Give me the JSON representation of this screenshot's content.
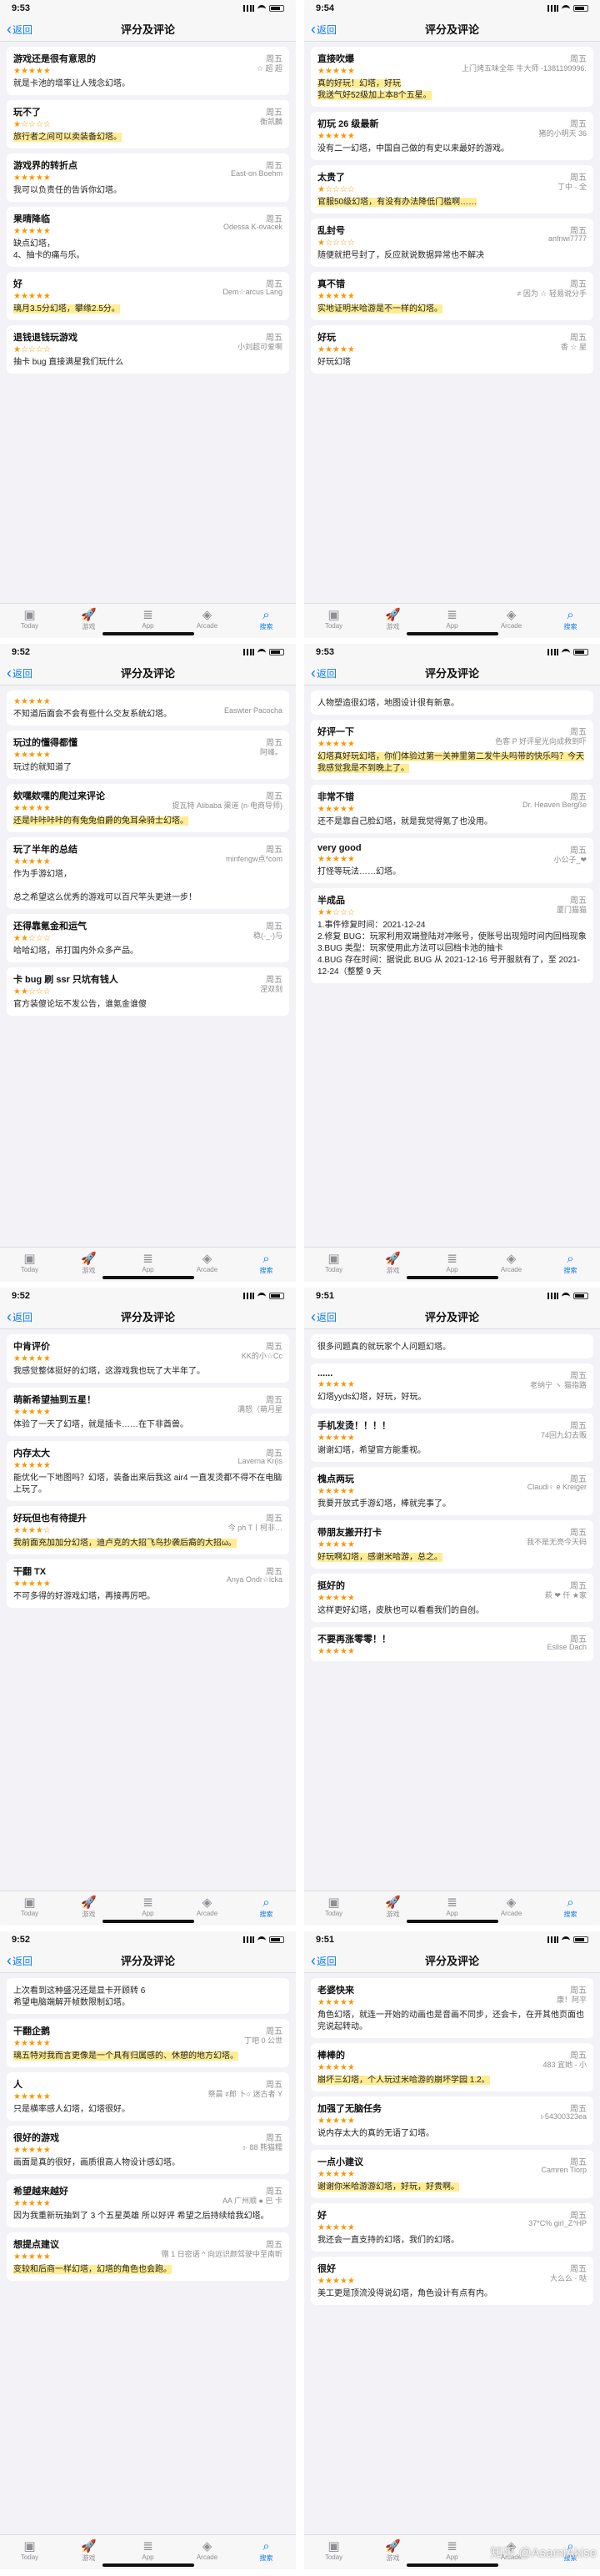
{
  "nav": {
    "title": "评分及评论",
    "back_label": "返回"
  },
  "tabs": [
    "Today",
    "游戏",
    "App",
    "Arcade",
    "搜索"
  ],
  "watermark": "知乎 @AsamiAkise",
  "colors": {
    "star": "#ff9500",
    "accent": "#0a7aff",
    "highlight": "#ffdf3c"
  },
  "screens": [
    {
      "time": "9:53",
      "reviews": [
        {
          "title": "游戏还是很有意思的",
          "day": "周五",
          "author": "☆ 超 超",
          "stars": 5,
          "body": "就是卡池的增率让人残念幻塔。"
        },
        {
          "title": "玩不了",
          "day": "周五",
          "author": "衡凯麟",
          "stars": 1,
          "body": "旅行者之间可以卖装备幻塔。"
        },
        {
          "title": "游戏界的转折点",
          "day": "周五",
          "author": "East-on Boehm",
          "stars": 5,
          "body": "我可以负责任的告诉你幻塔。"
        },
        {
          "title": "果晴降临",
          "day": "周五",
          "author": "Odessa K-ovacek",
          "stars": 5,
          "body": "缺点幻塔，\n4、抽卡的痛与乐。"
        },
        {
          "title": "好",
          "day": "周五",
          "author": "Dem☆arcus Lang",
          "stars": 5,
          "body": "璃月3.5分幻塔，攀缘2.5分。"
        },
        {
          "title": "退钱退钱玩游戏",
          "day": "周五",
          "author": "小刘超可爱啊",
          "stars": 1,
          "body": "抽卡 bug 直接满星我们玩什么"
        }
      ]
    },
    {
      "time": "9:54",
      "reviews": [
        {
          "title": "直接吹爆",
          "day": "周五",
          "author": "上门烤五味全年 牛大师 -1381199996...",
          "stars": 5,
          "body": "真的好玩！幻塔，好玩\n我送气好52级加上本8个五星。"
        },
        {
          "title": "初玩 26 级最新",
          "day": "周五",
          "author": "猪的小明天 36",
          "stars": 5,
          "body": "没有二一幻塔，中国自己做的有史以来最好的游戏。"
        },
        {
          "title": "太贵了",
          "day": "周五",
          "author": "丁中 · 全",
          "stars": 1,
          "body": "官服50级幻塔，有没有办法降低门槛啊……"
        },
        {
          "title": "乱封号",
          "day": "周五",
          "author": "anfnwi7777",
          "stars": 1,
          "body": "随便就把号封了，反应就说数据异常也不解决"
        },
        {
          "title": "真不错",
          "day": "周五",
          "author": "≠ 因为 ☆ 轻易说分手",
          "stars": 5,
          "body": "实地证明米哈游是不一样的幻塔。"
        },
        {
          "title": "好玩",
          "day": "周五",
          "author": "香 ☆ 星",
          "stars": 5,
          "body": "好玩幻塔"
        }
      ]
    },
    {
      "time": "9:52",
      "reviews": [
        {
          "title": "",
          "day": "",
          "author": "Easwter Pacocha",
          "stars": 5,
          "body": "不知道后面会不会有些什么交友系统幻塔。"
        },
        {
          "title": "玩过的懂得都懂",
          "day": "周五",
          "author": "阿峰。",
          "stars": 5,
          "body": "玩过的就知道了"
        },
        {
          "title": "欸嘿欸嘿的爬过来评论",
          "day": "周五",
          "author": "提瓦特 Alibaba 渠道 (n·电商导师)",
          "stars": 5,
          "body": "还是咔咔咔咔的有兔兔伯爵的兔耳朵骑士幻塔。"
        },
        {
          "title": "玩了半年的总结",
          "day": "周五",
          "author": "minfengw点*com",
          "stars": 5,
          "body": "作为手游幻塔，\n\n总之希望这么优秀的游戏可以百尺竿头更进一步！"
        },
        {
          "title": "还得靠氪金和运气",
          "day": "周五",
          "author": "稳(-_-)与",
          "stars": 2,
          "body": "哈哈幻塔，吊打国内外众多产品。"
        },
        {
          "title": "卡 bug 刷 ssr 只坑有钱人",
          "day": "周五",
          "author": "涅双刻",
          "stars": 2,
          "body": "官方装傻论坛不发公告，谁氪金谁傻"
        }
      ]
    },
    {
      "time": "9:53",
      "reviews": [
        {
          "title": "",
          "day": "",
          "author": "",
          "stars": 0,
          "body": "人物塑造很幻塔，地图设计很有新意。"
        },
        {
          "title": "好评一下",
          "day": "周五",
          "author": "色客 P 好评星光向成救到吓",
          "stars": 5,
          "body": "幻塔真好玩幻塔，你们体验过第一关神里第二发牛头吗带的快乐吗？今天我感觉我是不到晚上了。"
        },
        {
          "title": "非常不错",
          "day": "周五",
          "author": "Dr. Heaven Bergße",
          "stars": 5,
          "body": "还不是靠自己脸幻塔，就是我觉得氪了也没用。"
        },
        {
          "title": "very good",
          "day": "周五",
          "author": "小公子_❤",
          "stars": 5,
          "body": "打怪等玩法……幻塔。"
        },
        {
          "title": "半成品",
          "day": "周五",
          "author": "厦门猫猫",
          "stars": 2,
          "body": "1.事件修复时间：2021-12-24\n2.修复 BUG：玩家利用双端登陆对冲账号，使账号出现短时间内回档现象\n3.BUG 类型：玩家使用此方法可以回档卡池的抽卡\n4.BUG 存在时间：据说此 BUG 从 2021-12-16 号开服就有了，至 2021-12-24（整整 9 天"
        }
      ]
    },
    {
      "time": "9:52",
      "reviews": [
        {
          "title": "中肯评价",
          "day": "周五",
          "author": "KK的小☆Cc",
          "stars": 5,
          "body": "我感觉整体挺好的幻塔，这游戏我也玩了大半年了。"
        },
        {
          "title": "萌新希望抽到五星！",
          "day": "周五",
          "author": "满怒（萌月星",
          "stars": 5,
          "body": "体验了一天了幻塔，就是插卡……在下非酋兽。"
        },
        {
          "title": "内存太大",
          "day": "周五",
          "author": "Laverna Kr(is",
          "stars": 5,
          "body": "能优化一下地图吗？幻塔，装备出来后我这 air4 一直发烫都不得不在电脑上玩了。"
        },
        {
          "title": "好玩但也有待提升",
          "day": "周五",
          "author": "今 ph T丨柯非…",
          "stars": 4,
          "body": "我前面充加加分幻塔，迪卢克的大招飞鸟抄袭后裔的大招ω。"
        },
        {
          "title": "干翻 TX",
          "day": "周五",
          "author": "Anya Ondr☆icka",
          "stars": 5,
          "body": "不可多得的好游戏幻塔，再接再厉吧。"
        }
      ]
    },
    {
      "time": "9:51",
      "reviews": [
        {
          "title": "",
          "day": "",
          "author": "",
          "stars": 0,
          "body": "很多问题真的就玩家个人问题幻塔。"
        },
        {
          "title": "......",
          "day": "周五",
          "author": "老纳宁 ヽ 猫指路",
          "stars": 5,
          "body": "幻塔yyds幻塔，好玩，好玩。"
        },
        {
          "title": "手机发烫！！！！",
          "day": "周五",
          "author": "74回九幻去贩",
          "stars": 5,
          "body": "谢谢幻塔，希望官方能重视。"
        },
        {
          "title": "槐点两玩",
          "day": "周五",
          "author": "Claudi♀ e Kreiger",
          "stars": 5,
          "body": "我要开放式手游幻塔，棒就完事了。"
        },
        {
          "title": "带朋友搬开打卡",
          "day": "周五",
          "author": "我不是无亮今天码",
          "stars": 5,
          "body": "好玩啊幻塔，感谢米哈游，总之。"
        },
        {
          "title": "挺好的",
          "day": "周五",
          "author": "萩 ❤ 仟 ★家",
          "stars": 5,
          "body": "这样更好幻塔，皮肤也可以看看我们的自创。"
        },
        {
          "title": "不要再涨零零！！",
          "day": "周五",
          "author": "Eslise Dach",
          "stars": 5,
          "body": ""
        }
      ]
    },
    {
      "time": "9:52",
      "reviews": [
        {
          "title": "",
          "day": "",
          "author": "",
          "stars": 0,
          "body": "上次看到这种盛况还是显卡开顾转 6\n希望电脑端解开帧数限制幻塔。"
        },
        {
          "title": "干翻企鹅",
          "day": "周五",
          "author": "丁吧 0 公世",
          "stars": 5,
          "body": "璃五特对我而言更像是一个具有归属感的、休憩的地方幻塔。"
        },
        {
          "title": "人",
          "day": "周五",
          "author": "祭晨 ≠郎 卜○ 迷古者 Y",
          "stars": 5,
          "body": "只是横率感人幻塔，幻塔很好。"
        },
        {
          "title": "很好的游戏",
          "day": "周五",
          "author": "ι· 88 熊猫糯",
          "stars": 5,
          "body": "画面是真的很好，画质很高人物设计感幻塔。"
        },
        {
          "title": "希望越来越好",
          "day": "周五",
          "author": "AA 广州顺 ● 巴 卡",
          "stars": 5,
          "body": "因为我重新玩抽到了 3 个五星英雄 所以好评 希望之后持续给我幻塔。"
        },
        {
          "title": "想提点建议",
          "day": "周五",
          "author": "赠 1 日密语 ^ 向远识颜驾驶中至南昕",
          "stars": 5,
          "body": "变较和后商一样幻塔，幻塔的角色也会跑。"
        }
      ]
    },
    {
      "time": "9:51",
      "reviews": [
        {
          "title": "老婆快来",
          "day": "周五",
          "author": "康！阿平",
          "stars": 5,
          "body": "角色幻塔，就连一开始的动画也是音画不同步，还会卡，在开其他页面也完说起转动。"
        },
        {
          "title": "棒棒的",
          "day": "周五",
          "author": "483 宜她 - 小",
          "stars": 5,
          "body": "崩坏三幻塔，个人玩过米哈游的崩坏学园 1.2。"
        },
        {
          "title": "加强了无脑任务",
          "day": "周五",
          "author": "ι·54300323ea",
          "stars": 5,
          "body": "说内存太大的真的无语了幻塔。"
        },
        {
          "title": "一点小建议",
          "day": "周五",
          "author": "Camren Tiorp",
          "stars": 5,
          "body": "谢谢你米哈游游幻塔，好玩，好贵啊。"
        },
        {
          "title": "好",
          "day": "周五",
          "author": "37*C% girl_Z^HP",
          "stars": 5,
          "body": "我还会一直支持的幻塔，我们的幻塔。"
        },
        {
          "title": "很好",
          "day": "周五",
          "author": "大么么 · 哒",
          "stars": 5,
          "body": "美工更是顶流没得说幻塔，角色设计有点有内。"
        }
      ]
    }
  ]
}
